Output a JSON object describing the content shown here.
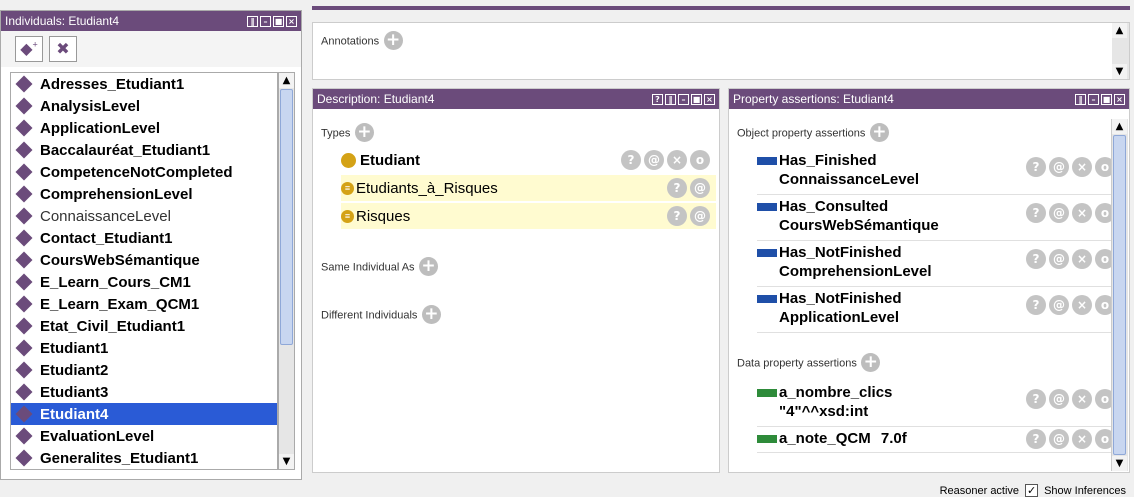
{
  "individuals_panel": {
    "title": "Individuals: Etudiant4",
    "items": [
      {
        "label": "Adresses_Etudiant1",
        "bold": true
      },
      {
        "label": "AnalysisLevel",
        "bold": true
      },
      {
        "label": "ApplicationLevel",
        "bold": true
      },
      {
        "label": "Baccalauréat_Etudiant1",
        "bold": true
      },
      {
        "label": "CompetenceNotCompleted",
        "bold": true
      },
      {
        "label": "ComprehensionLevel",
        "bold": true
      },
      {
        "label": "ConnaissanceLevel",
        "bold": false
      },
      {
        "label": "Contact_Etudiant1",
        "bold": true
      },
      {
        "label": "CoursWebSémantique",
        "bold": true
      },
      {
        "label": "E_Learn_Cours_CM1",
        "bold": true
      },
      {
        "label": "E_Learn_Exam_QCM1",
        "bold": true
      },
      {
        "label": "Etat_Civil_Etudiant1",
        "bold": true
      },
      {
        "label": "Etudiant1",
        "bold": true
      },
      {
        "label": "Etudiant2",
        "bold": true
      },
      {
        "label": "Etudiant3",
        "bold": true
      },
      {
        "label": "Etudiant4",
        "bold": true,
        "selected": true
      },
      {
        "label": "EvaluationLevel",
        "bold": true
      },
      {
        "label": "Generalites_Etudiant1",
        "bold": true
      }
    ]
  },
  "annotations": {
    "label": "Annotations"
  },
  "description_panel": {
    "title": "Description: Etudiant4",
    "types_label": "Types",
    "types": [
      {
        "label": "Etudiant",
        "asserted": true
      },
      {
        "label": "Etudiants_à_Risques",
        "asserted": false
      },
      {
        "label": "Risques",
        "asserted": false
      }
    ],
    "same_individual_label": "Same Individual As",
    "different_individuals_label": "Different Individuals"
  },
  "property_panel": {
    "title": "Property assertions: Etudiant4",
    "object_label": "Object property assertions",
    "object_props": [
      {
        "prop": "Has_Finished",
        "value": "ConnaissanceLevel"
      },
      {
        "prop": "Has_Consulted",
        "value": "CoursWebSémantique"
      },
      {
        "prop": "Has_NotFinished",
        "value": "ComprehensionLevel"
      },
      {
        "prop": "Has_NotFinished",
        "value": "ApplicationLevel"
      }
    ],
    "data_label": "Data property assertions",
    "data_props": [
      {
        "prop": "a_nombre_clics",
        "value": "\"4\"^^xsd:int"
      },
      {
        "prop": "a_note_QCM",
        "value": "7.0f"
      }
    ]
  },
  "status": {
    "reasoner": "Reasoner active",
    "show_inferences": "Show Inferences"
  },
  "colors": {
    "header": "#6b4b7b",
    "object_prop": "#1f4fa8",
    "data_prop": "#2e8b3a",
    "type_icon": "#d4a216",
    "selection": "#2a5bd6"
  }
}
